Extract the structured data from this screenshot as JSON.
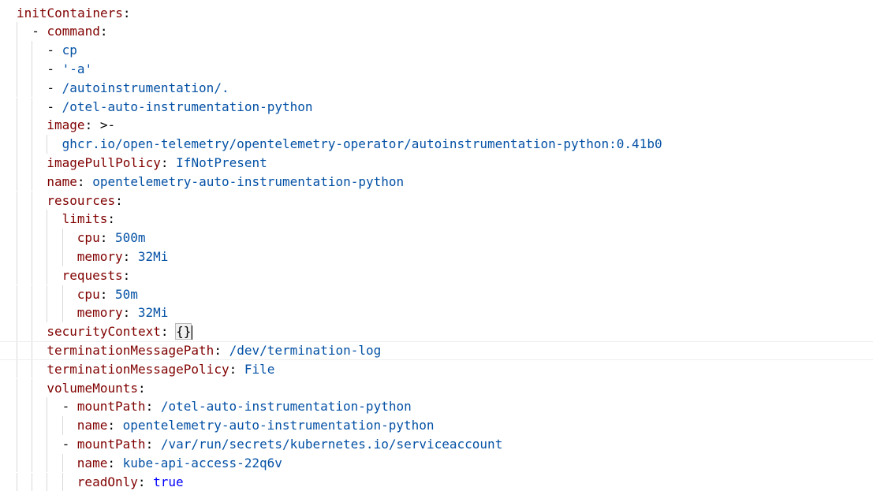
{
  "editor": {
    "language": "yaml",
    "cursor_line": 18,
    "colors": {
      "key": "#800000",
      "string_value": "#0451a5",
      "boolean_value": "#0000ff",
      "punctuation": "#000000",
      "indent_guide": "#d9d9d9"
    },
    "lines": [
      {
        "indent": 0,
        "dash": false,
        "key": "initContainers",
        "value": "",
        "value_type": ""
      },
      {
        "indent": 1,
        "dash": true,
        "key": "command",
        "value": "",
        "value_type": ""
      },
      {
        "indent": 2,
        "dash": true,
        "key": "",
        "value": "cp",
        "value_type": "string"
      },
      {
        "indent": 2,
        "dash": true,
        "key": "",
        "value": "'-a'",
        "value_type": "string"
      },
      {
        "indent": 2,
        "dash": true,
        "key": "",
        "value": "/autoinstrumentation/.",
        "value_type": "string"
      },
      {
        "indent": 2,
        "dash": true,
        "key": "",
        "value": "/otel-auto-instrumentation-python",
        "value_type": "string"
      },
      {
        "indent": 2,
        "dash": false,
        "key": "image",
        "value": ">-",
        "value_type": "indicator"
      },
      {
        "indent": 3,
        "dash": false,
        "key": "",
        "value": "ghcr.io/open-telemetry/opentelemetry-operator/autoinstrumentation-python:0.41b0",
        "value_type": "string"
      },
      {
        "indent": 2,
        "dash": false,
        "key": "imagePullPolicy",
        "value": "IfNotPresent",
        "value_type": "string"
      },
      {
        "indent": 2,
        "dash": false,
        "key": "name",
        "value": "opentelemetry-auto-instrumentation-python",
        "value_type": "string"
      },
      {
        "indent": 2,
        "dash": false,
        "key": "resources",
        "value": "",
        "value_type": ""
      },
      {
        "indent": 3,
        "dash": false,
        "key": "limits",
        "value": "",
        "value_type": ""
      },
      {
        "indent": 4,
        "dash": false,
        "key": "cpu",
        "value": "500m",
        "value_type": "string"
      },
      {
        "indent": 4,
        "dash": false,
        "key": "memory",
        "value": "32Mi",
        "value_type": "string"
      },
      {
        "indent": 3,
        "dash": false,
        "key": "requests",
        "value": "",
        "value_type": ""
      },
      {
        "indent": 4,
        "dash": false,
        "key": "cpu",
        "value": "50m",
        "value_type": "string"
      },
      {
        "indent": 4,
        "dash": false,
        "key": "memory",
        "value": "32Mi",
        "value_type": "string"
      },
      {
        "indent": 2,
        "dash": false,
        "key": "securityContext",
        "value": "{}",
        "value_type": "brace"
      },
      {
        "indent": 2,
        "dash": false,
        "key": "terminationMessagePath",
        "value": "/dev/termination-log",
        "value_type": "string"
      },
      {
        "indent": 2,
        "dash": false,
        "key": "terminationMessagePolicy",
        "value": "File",
        "value_type": "string"
      },
      {
        "indent": 2,
        "dash": false,
        "key": "volumeMounts",
        "value": "",
        "value_type": ""
      },
      {
        "indent": 3,
        "dash": true,
        "key": "mountPath",
        "value": "/otel-auto-instrumentation-python",
        "value_type": "string"
      },
      {
        "indent": 4,
        "dash": false,
        "key": "name",
        "value": "opentelemetry-auto-instrumentation-python",
        "value_type": "string"
      },
      {
        "indent": 3,
        "dash": true,
        "key": "mountPath",
        "value": "/var/run/secrets/kubernetes.io/serviceaccount",
        "value_type": "string"
      },
      {
        "indent": 4,
        "dash": false,
        "key": "name",
        "value": "kube-api-access-22q6v",
        "value_type": "string"
      },
      {
        "indent": 4,
        "dash": false,
        "key": "readOnly",
        "value": "true",
        "value_type": "boolean"
      }
    ]
  }
}
